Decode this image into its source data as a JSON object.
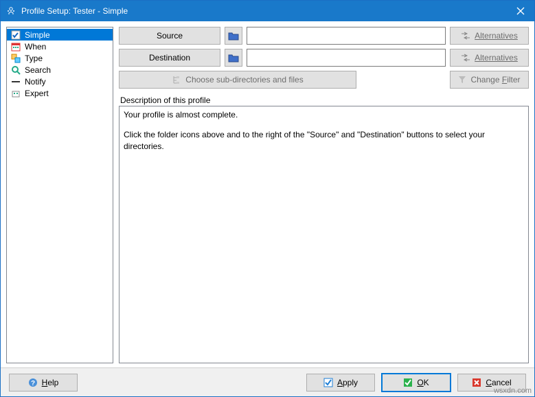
{
  "titlebar": {
    "title": "Profile Setup: Tester - Simple"
  },
  "sidebar": {
    "items": [
      {
        "label": "Simple"
      },
      {
        "label": "When"
      },
      {
        "label": "Type"
      },
      {
        "label": "Search"
      },
      {
        "label": "Notify"
      },
      {
        "label": "Expert"
      }
    ]
  },
  "main": {
    "source_label": "Source",
    "destination_label": "Destination",
    "source_value": "",
    "destination_value": "",
    "alternatives_label": "Alternatives",
    "choose_sub_label": "Choose sub-directories and files",
    "change_filter_label": "Change Filter",
    "description_label": "Description of this profile",
    "description_text_1": "Your profile is almost complete.",
    "description_text_2": "Click the folder icons above and to the right of the \"Source\" and \"Destination\" buttons to select your directories."
  },
  "footer": {
    "help_label": "Help",
    "apply_label": "Apply",
    "ok_label": "OK",
    "cancel_label": "Cancel"
  },
  "watermark": "wsxdn.com"
}
